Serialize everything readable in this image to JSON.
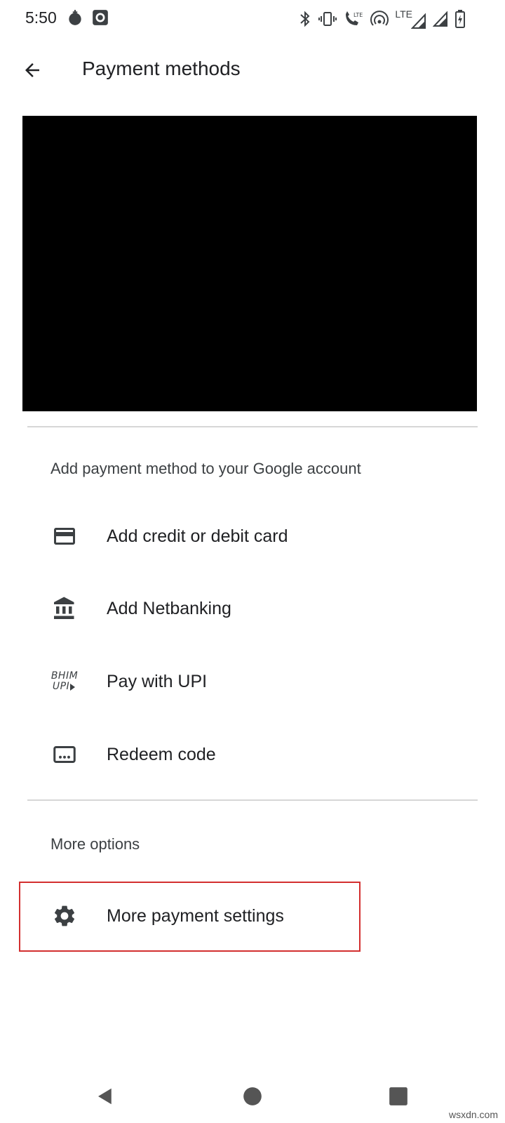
{
  "status_bar": {
    "time": "5:50",
    "left_icons": [
      "tomato-icon",
      "camera-icon"
    ],
    "right_icons": [
      "bluetooth-icon",
      "vibrate-icon",
      "volte-call-icon",
      "hotspot-icon",
      "lte-signal-icon",
      "signal-icon",
      "battery-charging-icon"
    ],
    "lte_label": "LTE"
  },
  "app_bar": {
    "title": "Payment methods",
    "back_icon": "arrow-back-icon"
  },
  "add_section": {
    "header": "Add payment method to your Google account",
    "items": [
      {
        "label": "Add credit or debit card",
        "icon": "credit-card-icon"
      },
      {
        "label": "Add Netbanking",
        "icon": "bank-icon"
      },
      {
        "label": "Pay with UPI",
        "icon": "bhim-upi-icon",
        "icon_text_top": "BHIM",
        "icon_text_bottom": "UPI"
      },
      {
        "label": "Redeem code",
        "icon": "redeem-code-icon"
      }
    ]
  },
  "more_section": {
    "header": "More options",
    "items": [
      {
        "label": "More payment settings",
        "icon": "gear-icon"
      }
    ]
  },
  "nav_bar": {
    "buttons": [
      "nav-back-icon",
      "nav-home-icon",
      "nav-recents-icon"
    ]
  },
  "watermark": "wsxdn.com",
  "colors": {
    "highlight_border": "#d32f2f",
    "text_primary": "#202124",
    "divider": "#d6d6d6"
  }
}
